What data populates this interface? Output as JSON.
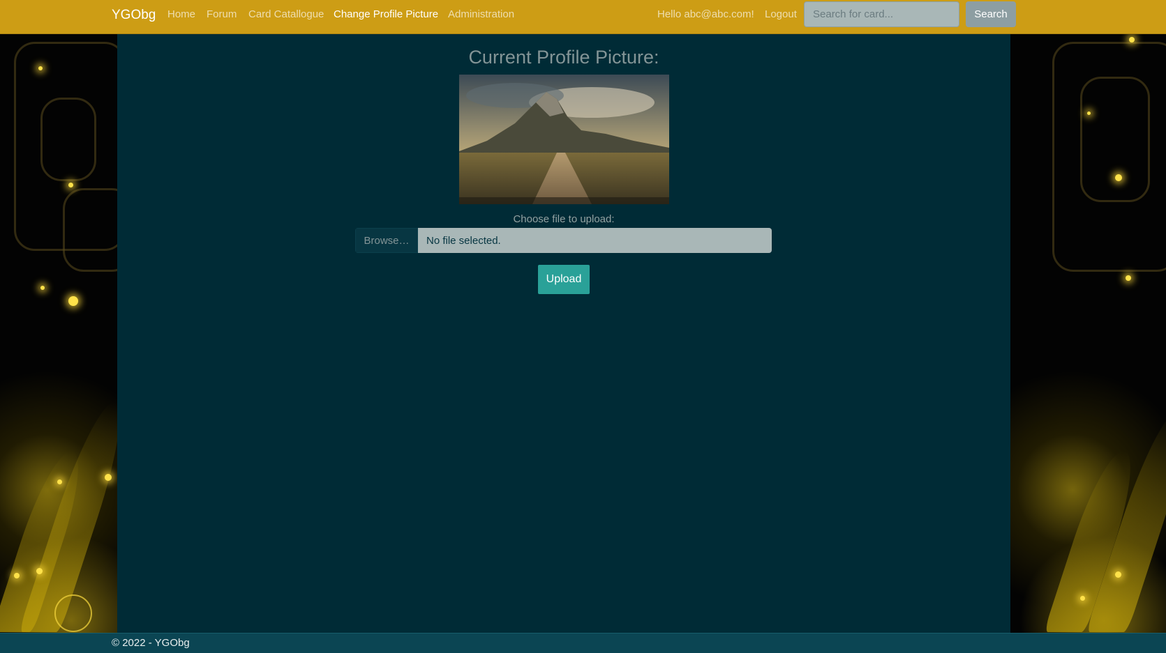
{
  "navbar": {
    "brand": "YGObg",
    "links": [
      {
        "label": "Home"
      },
      {
        "label": "Forum"
      },
      {
        "label": "Card Catallogue"
      },
      {
        "label": "Change Profile Picture"
      },
      {
        "label": "Administration"
      }
    ],
    "greeting": "Hello abc@abc.com!",
    "logout": "Logout",
    "search_placeholder": "Search for card...",
    "search_button": "Search"
  },
  "main": {
    "title": "Current Profile Picture:",
    "choose_label": "Choose file to upload:",
    "browse_label": "Browse…",
    "file_status": "No file selected.",
    "upload_button": "Upload"
  },
  "footer": {
    "text": "© 2022 - YGObg"
  },
  "colors": {
    "navbar": "#cd9d15",
    "container": "#002b36",
    "upload_button": "#2aa198",
    "footer": "#0b4553"
  }
}
